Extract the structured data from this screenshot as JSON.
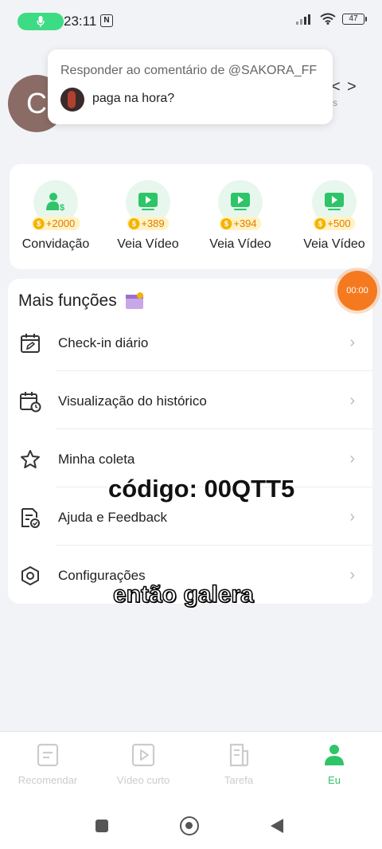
{
  "status_bar": {
    "time": "23:11",
    "nfc": "N",
    "battery": "47"
  },
  "profile": {
    "avatar_letter": "C",
    "mark": "<",
    "arrow": ">",
    "sub": "s"
  },
  "reply_popup": {
    "title": "Responder ao comentário de @SAKORA_FF",
    "text": "paga na hora?"
  },
  "rewards": [
    {
      "amount": "+2000",
      "label": "Convidação",
      "icon": "invite-user-icon"
    },
    {
      "amount": "+389",
      "label": "Veia Vídeo",
      "icon": "video-play-icon"
    },
    {
      "amount": "+394",
      "label": "Veia Vídeo",
      "icon": "video-play-icon"
    },
    {
      "amount": "+500",
      "label": "Veia Vídeo",
      "icon": "video-play-icon"
    }
  ],
  "functions": {
    "title": "Mais funções",
    "items": [
      {
        "label": "Check-in diário",
        "icon": "calendar-edit-icon"
      },
      {
        "label": "Visualização do histórico",
        "icon": "history-calendar-icon"
      },
      {
        "label": "Minha coleta",
        "icon": "star-icon"
      },
      {
        "label": "Ajuda e Feedback",
        "icon": "document-check-icon"
      },
      {
        "label": "Configurações",
        "icon": "settings-hexagon-icon"
      }
    ]
  },
  "timer": {
    "value": "00:00"
  },
  "overlay": {
    "code": "código: 00QTT5",
    "caption": "então galera"
  },
  "bottom_nav": {
    "items": [
      {
        "label": "Recomendar",
        "icon": "recommend-icon"
      },
      {
        "label": "Vídeo curto",
        "icon": "short-video-icon"
      },
      {
        "label": "Tarefa",
        "icon": "task-icon"
      },
      {
        "label": "Eu",
        "icon": "user-icon"
      }
    ],
    "active": "Eu"
  },
  "colors": {
    "accent_green": "#2ec468",
    "coin_orange": "#e07a00",
    "timer_orange": "#f57a1f"
  }
}
